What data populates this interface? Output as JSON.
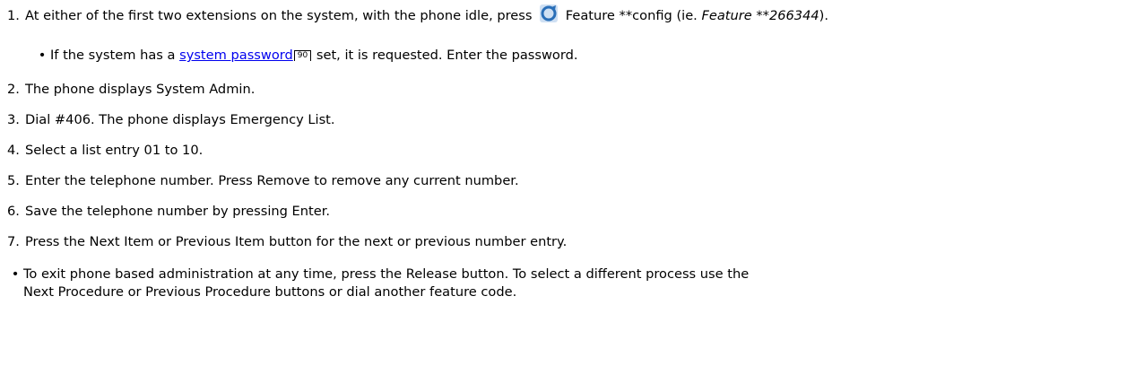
{
  "steps": [
    {
      "num": "1.",
      "pre": "At either of the first two extensions on the system, with the phone idle, press",
      "mid": "Feature **config (ie.",
      "code": "Feature **266344",
      "post": ")."
    },
    {
      "num": "2.",
      "text": "The phone displays System Admin."
    },
    {
      "num": "3.",
      "text": "Dial #406. The phone displays Emergency List."
    },
    {
      "num": "4.",
      "text": "Select a list entry 01 to 10."
    },
    {
      "num": "5.",
      "text": "Enter the telephone number. Press Remove to remove any current number."
    },
    {
      "num": "6.",
      "text": "Save the telephone number by pressing Enter."
    },
    {
      "num": "7.",
      "text": "Press the Next Item or Previous Item button for the next or previous number entry."
    }
  ],
  "substep": {
    "pre": "If the system has a",
    "link": "system password",
    "page_ref": "90",
    "post": "set, it is requested. Enter the password."
  },
  "note": {
    "line1": "To exit phone based administration at any time, press the Release button. To select a different process use the",
    "line2": "Next Procedure or Previous Procedure buttons or dial another feature code."
  },
  "icons": {
    "feature": "feature-button-icon"
  },
  "colors": {
    "link": "#0000ee",
    "icon_blue": "#2a6fb8"
  }
}
